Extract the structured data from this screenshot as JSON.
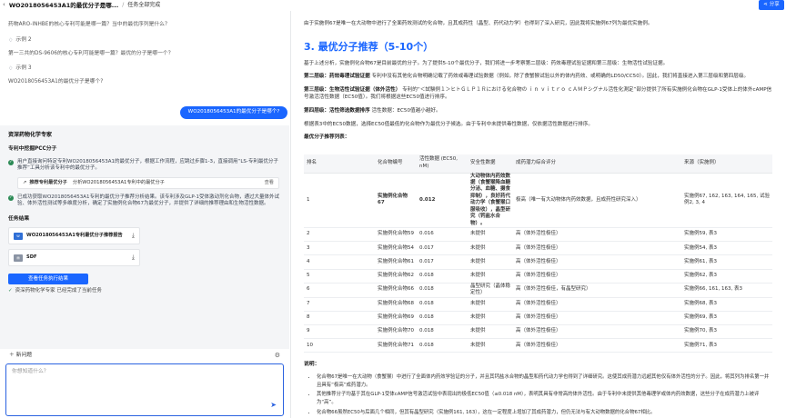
{
  "header": {
    "back_icon": "chevron-left-icon",
    "title": "WO2018056453A1的最优分子是哪...",
    "breadcrumb": "任务全部完成",
    "share_label": "分享"
  },
  "left": {
    "messages": [
      {
        "kind": "q",
        "text": "药物ARO-INHBE的核心专利可能是哪一篇？当中的最优序列是什么？"
      },
      {
        "kind": "example",
        "text": "示例 2"
      },
      {
        "kind": "q",
        "text": "第一三共的DS-9606的核心专利可能是哪一篇？最优的分子是哪一个？"
      },
      {
        "kind": "example",
        "text": "示例 3"
      },
      {
        "kind": "q",
        "text": "WO2018056453A1的最优分子是哪个?"
      }
    ],
    "user_message": "WO2018056453A1的最优分子是哪个?",
    "agent": {
      "name": "资深药物化学专家",
      "subtitle": "专利中挖掘PCC分子",
      "step1": "用户直接询问特定专利WO2018056453A1的最优分子，根据工作流程，应跳过步骤1-3，直接调用“LS-专利最优分子推荐”工具分析该专利中的最优分子。",
      "tool_label": "推荐专利最优分子",
      "tool_desc": "分析WO2018056453A1专利中的最优分子",
      "tool_action": "查看",
      "step2": "已成功获取WO2018056453A1专利的最优分子推荐分析结果。该专利涉及GLP-1受体激动剂化合物，通过大量体外试验、体外活性测试等多维度分析，确定了实施例化合物67为最优分子，并提供了详细的推荐理由和生物活性数据。",
      "results_title": "任务结果",
      "files": [
        {
          "name": "WO2018056453A1专利最优分子推荐报告",
          "type": "word"
        },
        {
          "name": "SDF",
          "type": "file"
        }
      ],
      "view_button": "查看任务执行结果",
      "done_text": "资深药物化学专家 已经完成了当前任务"
    },
    "new_question": "新问题",
    "input_placeholder": "你想知道什么？"
  },
  "right": {
    "intro": "由于实施例67是唯一在大动物中进行了全面药效测试的化合物，且其成药性（晶型、药代动力学）也得到了深入研究，因此我将实施例67列为最优实施例。",
    "section_title": "3. 最优分子推荐（5-10个）",
    "p1": "基于上述分析，实施例化合物67是目前最优的分子。为了提供5-10个最优分子，我们将进一步考察第二层级：药效毒理试验证据和第三层级：生物活性试验证据。",
    "p2_label": "第二层级：药效毒理试验证据",
    "p2": "专利中没有其他化合物明确记载了药效或毒理试验数据（例如，除了食蟹猴试验以外的体内药效、或明确的LD50/CC50）。因此，我们将直接进入第三层级和第四层级。",
    "p3_label": "第三层级：生物活性试验证据（体外活性）",
    "p3": "专利的“＜試験例１＞ヒトＧＬＰ１Ｒにおける化合物の ｉｎ ｖｉｔｒｏ ｃＡＭＰシグナル活性化測定”部分提供了所有实施例化合物在GLP-1受体上的体外cAMP信号激活活性数据（EC50值）。我们将根据这些EC50值进行排序。",
    "p4_label": "第四层级：活性筛选数据排序",
    "p4": "活性数据：EC50值越小越好。",
    "p5": "根据表3中的EC50数据，选择EC50值最低的化合物作为最优分子候选。由于专利中未提供毒性数据，仅依据活性数据进行排序。",
    "list_title": "最优分子推荐列表：",
    "table": {
      "headers": [
        "排名",
        "化合物编号",
        "活性数据 (EC50, nM)",
        "安全性数据",
        "成药潜力综合评分",
        "来源（实施例）"
      ],
      "rows": [
        [
          "1",
          "实施例化合物67",
          "0.012",
          "大动物体内药效数据（食蟹猴降血糖分泌、血糖、摄食抑制），良好药代动力学（食蟹猴口服吸收），晶型研究（钙盐水合物）。",
          "极高（唯一有大动物体内药效数据，且成药性研究深入）",
          "实施例67, 162, 163, 164, 165, 试验例2, 3, 4"
        ],
        [
          "2",
          "实施例化合物59",
          "0.016",
          "未提供",
          "高（体外活性极佳）",
          "实施例59, 表3"
        ],
        [
          "3",
          "实施例化合物54",
          "0.017",
          "未提供",
          "高（体外活性极佳）",
          "实施例54, 表3"
        ],
        [
          "4",
          "实施例化合物61",
          "0.017",
          "未提供",
          "高（体外活性极佳）",
          "实施例61, 表3"
        ],
        [
          "5",
          "实施例化合物62",
          "0.018",
          "未提供",
          "高（体外活性极佳）",
          "实施例62, 表3"
        ],
        [
          "6",
          "实施例化合物66",
          "0.018",
          "晶型研究（晶体稳定性）",
          "高（体外活性极佳，有晶型研究）",
          "实施例66, 161, 163, 表3"
        ],
        [
          "7",
          "实施例化合物68",
          "0.018",
          "未提供",
          "高（体外活性极佳）",
          "实施例68, 表3"
        ],
        [
          "8",
          "实施例化合物69",
          "0.018",
          "未提供",
          "高（体外活性极佳）",
          "实施例69, 表3"
        ],
        [
          "9",
          "实施例化合物70",
          "0.018",
          "未提供",
          "高（体外活性极佳）",
          "实施例70, 表3"
        ],
        [
          "10",
          "实施例化合物71",
          "0.018",
          "未提供",
          "高（体外活性极佳）",
          "实施例71, 表3"
        ]
      ]
    },
    "notes_title": "说明：",
    "notes": [
      "化合物67是唯一在大动物（食蟹猴）中进行了全面体内药效学验证的分子，并且其钙盐水合物的晶型和药代动力学也得到了详细研究。这使其成药潜力远超其他仅有体外活性的分子。因此，将其列为排名第一并且具有“极高”成药潜力。",
      "其他推荐分子均基于其在GLP-1受体cAMP信号激活试验中表现出的极低EC50值（≤0.018 nM），表明其具有非常高的体外活性。由于专利中未提供其他毒理学或体内药效数据，这些分子在成药潜力上被评为“高”。",
      "化合物66虽然EC50与后面几个相同，但其有晶型研究（实施例161, 163），这在一定程度上增加了其成药潜力，但仍无法与有大动物数据的化合物67相比。"
    ]
  }
}
